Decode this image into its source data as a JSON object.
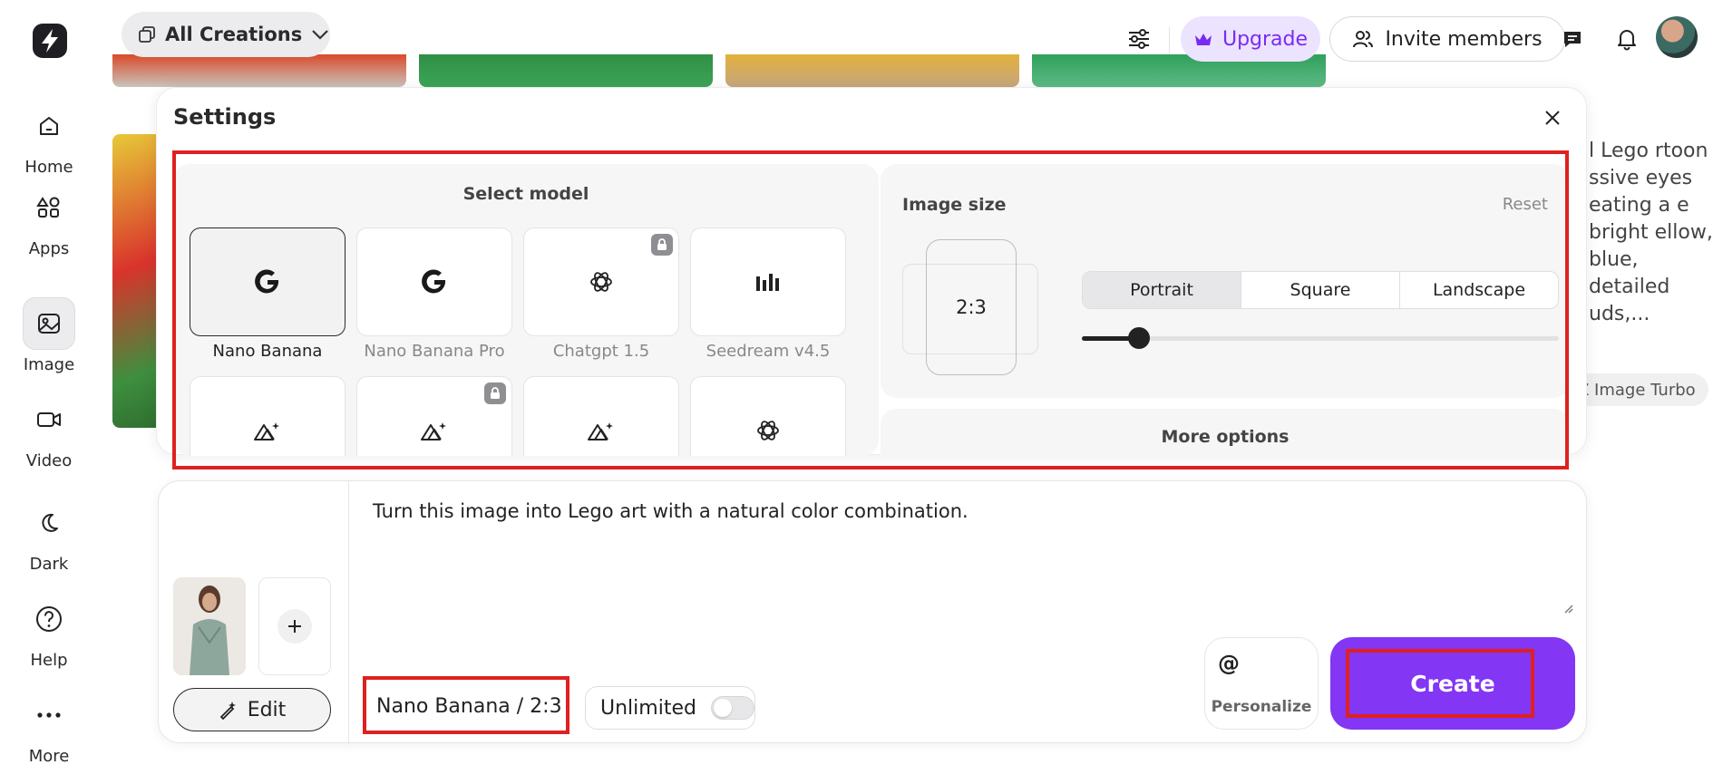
{
  "brand": {
    "accent": "#8336f4",
    "highlight": "#e02020"
  },
  "sidebar": {
    "items": [
      {
        "label": "Home",
        "icon": "home-icon"
      },
      {
        "label": "Apps",
        "icon": "apps-icon"
      },
      {
        "label": "Image",
        "icon": "image-icon",
        "active": true
      },
      {
        "label": "Video",
        "icon": "video-icon"
      },
      {
        "label": "Dark",
        "icon": "moon-icon"
      },
      {
        "label": "Help",
        "icon": "help-icon"
      },
      {
        "label": "More",
        "icon": "more-icon"
      }
    ]
  },
  "topbar": {
    "filter": "All Creations",
    "upgrade": "Upgrade",
    "invite": "Invite members"
  },
  "background": {
    "side_text": "l Lego rtoon ssive eyes eating a e bright ellow, blue, detailed uds,...",
    "side_badge": "Z Image Turbo"
  },
  "settings": {
    "title": "Settings",
    "select_model": "Select model",
    "models": [
      {
        "label": "Nano Banana",
        "icon": "google-icon",
        "selected": true,
        "locked": false
      },
      {
        "label": "Nano Banana Pro",
        "icon": "google-icon",
        "selected": false,
        "locked": false
      },
      {
        "label": "Chatgpt 1.5",
        "icon": "openai-icon",
        "selected": false,
        "locked": true
      },
      {
        "label": "Seedream v4.5",
        "icon": "seedream-icon",
        "selected": false,
        "locked": false
      },
      {
        "label": "",
        "icon": "mountain-sparkle-icon",
        "selected": false,
        "locked": false
      },
      {
        "label": "",
        "icon": "mountain-sparkle-icon",
        "selected": false,
        "locked": true
      },
      {
        "label": "",
        "icon": "mountain-sparkle-icon",
        "selected": false,
        "locked": false
      },
      {
        "label": "",
        "icon": "openai-icon",
        "selected": false,
        "locked": false
      }
    ],
    "image_size": {
      "title": "Image size",
      "reset": "Reset",
      "ratio": "2:3",
      "orientations": [
        "Portrait",
        "Square",
        "Landscape"
      ],
      "active_orientation": "Portrait",
      "slider_fraction": 0.12
    },
    "more_options": "More options"
  },
  "prompt": {
    "text": "Turn this image into Lego art with a natural color combination.",
    "edit_label": "Edit",
    "model_chip": "Nano Banana / 2:3",
    "unlimited_label": "Unlimited",
    "unlimited_on": false,
    "personalize_symbol": "@",
    "personalize_label": "Personalize",
    "create_label": "Create"
  }
}
